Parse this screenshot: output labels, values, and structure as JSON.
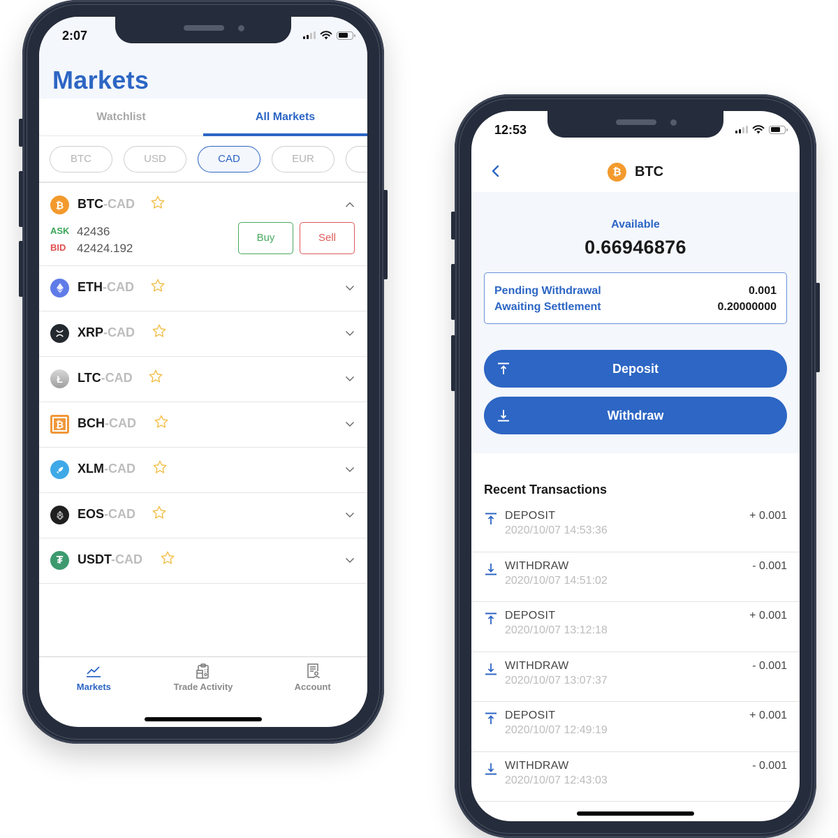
{
  "left_phone": {
    "status": {
      "time": "2:07"
    },
    "title": "Markets",
    "tabs": [
      {
        "label": "Watchlist",
        "active": false
      },
      {
        "label": "All Markets",
        "active": true
      }
    ],
    "currency_chips": [
      {
        "label": "BTC",
        "active": false
      },
      {
        "label": "USD",
        "active": false
      },
      {
        "label": "CAD",
        "active": true
      },
      {
        "label": "EUR",
        "active": false
      },
      {
        "label": "",
        "active": false
      }
    ],
    "pairs": [
      {
        "base": "BTC",
        "quote": "-CAD",
        "icon": "bitcoin-icon",
        "color": "#f39a2d",
        "expanded": true,
        "ask_label": "ASK",
        "ask": "42436",
        "bid_label": "BID",
        "bid": "42424.192",
        "buy_label": "Buy",
        "sell_label": "Sell"
      },
      {
        "base": "ETH",
        "quote": "-CAD",
        "icon": "ethereum-icon",
        "color": "#5f7be8",
        "expanded": false
      },
      {
        "base": "XRP",
        "quote": "-CAD",
        "icon": "ripple-icon",
        "color": "#23292f",
        "expanded": false
      },
      {
        "base": "LTC",
        "quote": "-CAD",
        "icon": "litecoin-icon",
        "color": "#b8b8b8",
        "expanded": false
      },
      {
        "base": "BCH",
        "quote": "-CAD",
        "icon": "bitcoin-cash-icon",
        "color": "#f0973a",
        "expanded": false
      },
      {
        "base": "XLM",
        "quote": "-CAD",
        "icon": "stellar-icon",
        "color": "#3fa9e8",
        "expanded": false
      },
      {
        "base": "EOS",
        "quote": "-CAD",
        "icon": "eos-icon",
        "color": "#1f1f1f",
        "expanded": false
      },
      {
        "base": "USDT",
        "quote": "-CAD",
        "icon": "tether-icon",
        "color": "#3d9a6f",
        "expanded": false
      }
    ],
    "tabbar": [
      {
        "label": "Markets",
        "icon": "chart-line-icon",
        "active": true
      },
      {
        "label": "Trade Activity",
        "icon": "clipboard-icon",
        "active": false
      },
      {
        "label": "Account",
        "icon": "account-document-icon",
        "active": false
      }
    ]
  },
  "right_phone": {
    "status": {
      "time": "12:53"
    },
    "nav": {
      "title": "BTC",
      "coin_icon": "bitcoin-icon"
    },
    "available_label": "Available",
    "available_value": "0.66946876",
    "pending": [
      {
        "label": "Pending Withdrawal",
        "value": "0.001"
      },
      {
        "label": "Awaiting Settlement",
        "value": "0.20000000"
      }
    ],
    "deposit_label": "Deposit",
    "withdraw_label": "Withdraw",
    "recent_title": "Recent Transactions",
    "transactions": [
      {
        "type": "DEPOSIT",
        "date": "2020/10/07 14:53:36",
        "amount": "+ 0.001"
      },
      {
        "type": "WITHDRAW",
        "date": "2020/10/07 14:51:02",
        "amount": "- 0.001"
      },
      {
        "type": "DEPOSIT",
        "date": "2020/10/07 13:12:18",
        "amount": "+ 0.001"
      },
      {
        "type": "WITHDRAW",
        "date": "2020/10/07 13:07:37",
        "amount": "- 0.001"
      },
      {
        "type": "DEPOSIT",
        "date": "2020/10/07 12:49:19",
        "amount": "+ 0.001"
      },
      {
        "type": "WITHDRAW",
        "date": "2020/10/07 12:43:03",
        "amount": "- 0.001"
      }
    ]
  },
  "colors": {
    "accent": "#2d66c4",
    "ask_green": "#3aa657",
    "bid_red": "#df4f4f",
    "star": "#f2c14e",
    "frame": "#252c3b"
  }
}
